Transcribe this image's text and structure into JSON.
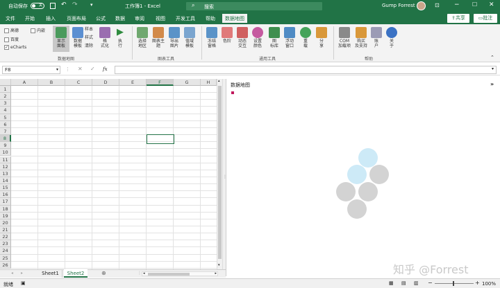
{
  "titlebar": {
    "autosave": "自动保存",
    "autosave_state": "关",
    "doc_title": "工作簿1 - Excel",
    "search_placeholder": "搜索",
    "user": "Gump Forrest"
  },
  "tabs": [
    "文件",
    "开始",
    "插入",
    "页面布局",
    "公式",
    "数据",
    "审阅",
    "视图",
    "开发工具",
    "帮助",
    "数据地图"
  ],
  "share": "共享",
  "comments": "批注",
  "checks": [
    {
      "label": "高德",
      "checked": false
    },
    {
      "label": "百度",
      "checked": false
    },
    {
      "label": "eCharts",
      "checked": true
    },
    {
      "label": "内嵌",
      "checked": false
    }
  ],
  "ribbon": {
    "b1": "显示\n面板",
    "b2": "数据\n模板",
    "b3a": "样本",
    "b3b": "样式",
    "b3c": "清除",
    "b4": "格\n式化",
    "b5": "执\n行",
    "b6": "选择\n地区",
    "b7": "图表主\n题",
    "b8": "导出\n图片",
    "b9": "值域\n模板",
    "b10": "冻结\n窗格",
    "b11": "色阶",
    "b12": "动态\n交互",
    "b13": "设置\n颜色",
    "b14": "图\n标库",
    "b15": "浮动\n窗口",
    "b16": "重\n载",
    "b17": "分\n享",
    "b18": "COM\n加载项",
    "b19": "购买\n及支持",
    "b20": "账\n户",
    "b21": "关\n于",
    "g1": "数据地图",
    "g2": "图表工具",
    "g3": "通用工具",
    "g4": "帮助"
  },
  "formula": {
    "namebox": "F8",
    "fx": "fx",
    "value": ""
  },
  "columns": [
    "A",
    "B",
    "C",
    "D",
    "E",
    "F",
    "G",
    "H"
  ],
  "rows": [
    "1",
    "2",
    "3",
    "4",
    "5",
    "6",
    "7",
    "8",
    "9",
    "10",
    "11",
    "12",
    "13",
    "14",
    "15",
    "16",
    "17",
    "18",
    "19",
    "20",
    "21",
    "22",
    "23",
    "24",
    "25",
    "26"
  ],
  "pane_title": "数据地图",
  "sheets": [
    "Sheet1",
    "Sheet2"
  ],
  "status": "就绪",
  "zoom": "100%",
  "watermark": "知乎 @Forrest"
}
